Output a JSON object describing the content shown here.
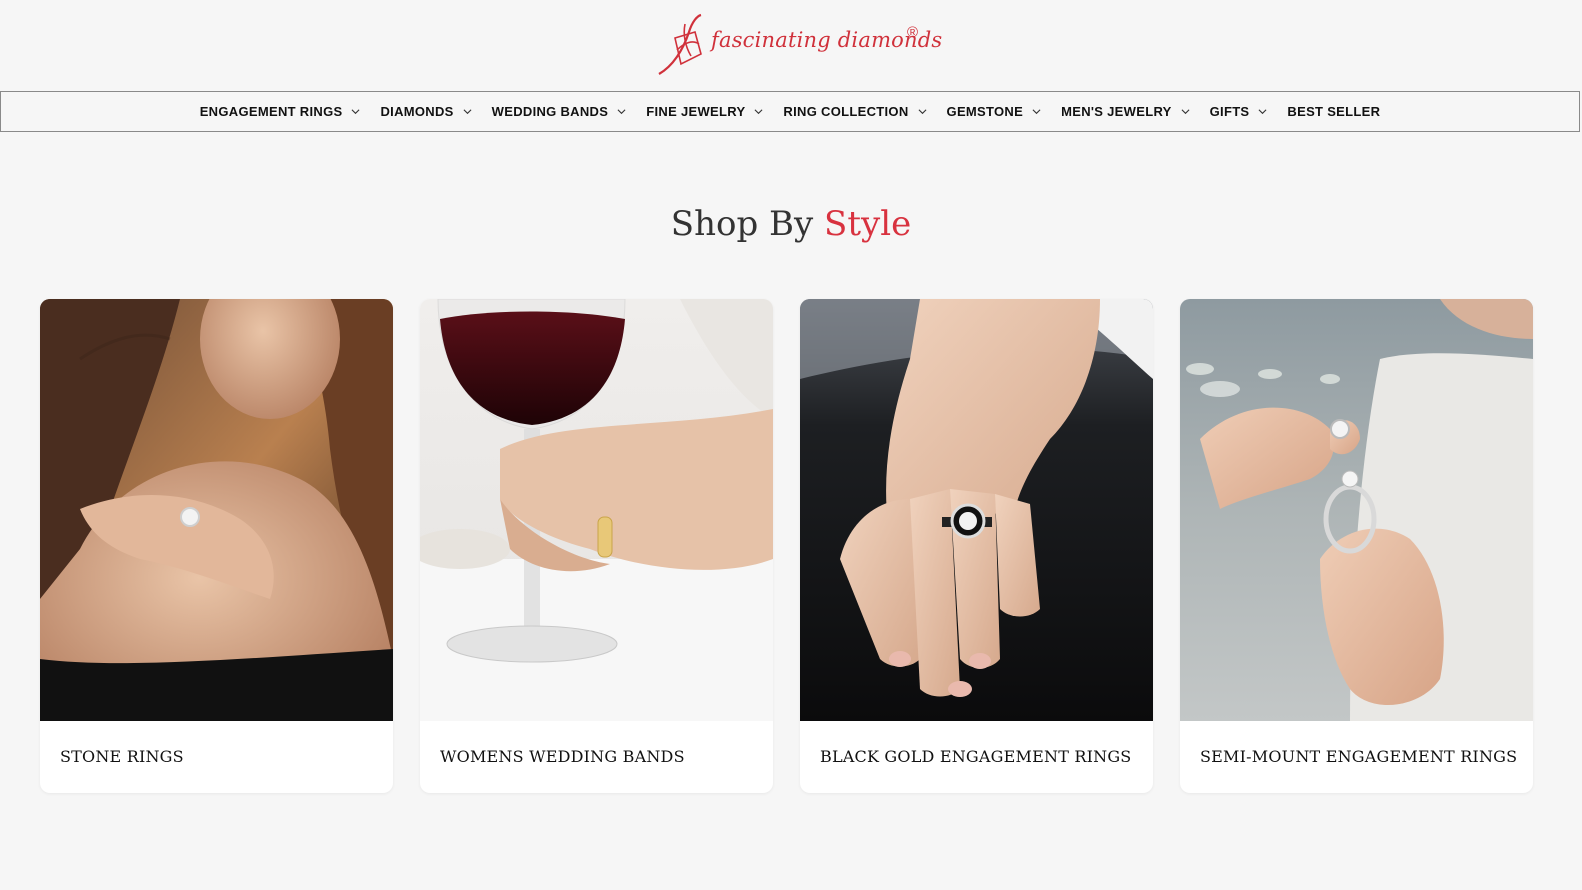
{
  "brand": {
    "name": "fascinating diamonds",
    "registered_mark": "®",
    "color": "#d0313b"
  },
  "nav": {
    "items": [
      {
        "label": "ENGAGEMENT RINGS",
        "has_dropdown": true,
        "icon": "chevron-down-icon"
      },
      {
        "label": "DIAMONDS",
        "has_dropdown": true,
        "icon": "chevron-down-icon"
      },
      {
        "label": "WEDDING BANDS",
        "has_dropdown": true,
        "icon": "chevron-down-icon"
      },
      {
        "label": "FINE JEWELRY",
        "has_dropdown": true,
        "icon": "chevron-down-icon"
      },
      {
        "label": "RING COLLECTION",
        "has_dropdown": true,
        "icon": "chevron-down-icon"
      },
      {
        "label": "GEMSTONE",
        "has_dropdown": true,
        "icon": "chevron-down-icon"
      },
      {
        "label": "MEN'S JEWELRY",
        "has_dropdown": true,
        "icon": "chevron-down-icon"
      },
      {
        "label": "GIFTS",
        "has_dropdown": true,
        "icon": "chevron-down-icon"
      },
      {
        "label": "BEST SELLER",
        "has_dropdown": false
      }
    ]
  },
  "section": {
    "title_prefix": "Shop By",
    "title_accent": "Style",
    "accent_color": "#d8323f"
  },
  "cards": [
    {
      "label": "STONE RINGS",
      "image": "woman-shoulder-ring-photo"
    },
    {
      "label": "WOMENS WEDDING BANDS",
      "image": "wine-glass-hand-ring-photo"
    },
    {
      "label": "BLACK GOLD ENGAGEMENT RINGS",
      "image": "hand-black-gold-ring-photo"
    },
    {
      "label": "SEMI-MOUNT ENGAGEMENT RINGS",
      "image": "hands-holding-ring-photo"
    }
  ]
}
